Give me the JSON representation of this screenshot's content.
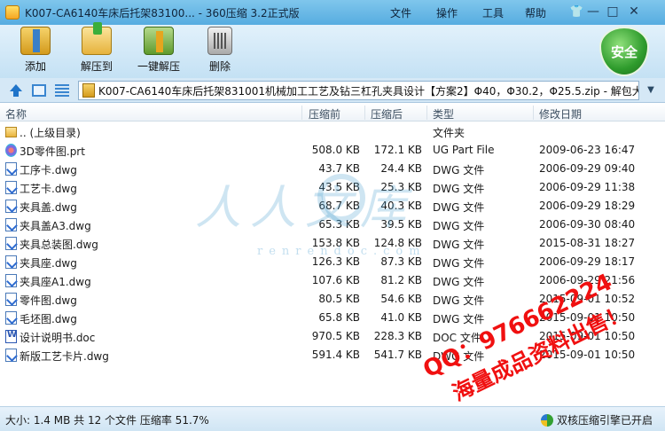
{
  "window": {
    "title": "K007-CA6140车床后托架83100... - 360压缩 3.2正式版",
    "menu": [
      "文件",
      "操作",
      "工具",
      "帮助"
    ],
    "controls": {
      "minimize": "—",
      "maximize": "□",
      "close": "✕"
    }
  },
  "toolbar": {
    "add": "添加",
    "extract": "解压到",
    "one_click": "一键解压",
    "delete": "删除",
    "security_badge": "安全"
  },
  "address": {
    "path": "K007-CA6140车床后托架831001机械加工工艺及钻三杠孔夹具设计【方案2】Φ40，Φ30.2，Φ25.5.zip - 解包大小",
    "dropdown_glyph": "▼"
  },
  "columns": {
    "name": "名称",
    "size": "压缩前",
    "compressed": "压缩后",
    "type": "类型",
    "modified": "修改日期"
  },
  "files": [
    {
      "icon": "folder-icon",
      "name": ".. (上级目录)",
      "size": "",
      "compressed": "",
      "type": "文件夹",
      "modified": ""
    },
    {
      "icon": "prt-file-icon",
      "name": "3D零件图.prt",
      "size": "508.0 KB",
      "compressed": "172.1 KB",
      "type": "UG Part File",
      "modified": "2009-06-23 16:47"
    },
    {
      "icon": "dwg-file-icon",
      "name": "工序卡.dwg",
      "size": "43.7 KB",
      "compressed": "24.4 KB",
      "type": "DWG 文件",
      "modified": "2006-09-29 09:40"
    },
    {
      "icon": "dwg-file-icon",
      "name": "工艺卡.dwg",
      "size": "43.5 KB",
      "compressed": "25.3 KB",
      "type": "DWG 文件",
      "modified": "2006-09-29 11:38"
    },
    {
      "icon": "dwg-file-icon",
      "name": "夹具盖.dwg",
      "size": "68.7 KB",
      "compressed": "40.3 KB",
      "type": "DWG 文件",
      "modified": "2006-09-29 18:29"
    },
    {
      "icon": "dwg-file-icon",
      "name": "夹具盖A3.dwg",
      "size": "65.3 KB",
      "compressed": "39.5 KB",
      "type": "DWG 文件",
      "modified": "2006-09-30 08:40"
    },
    {
      "icon": "dwg-file-icon",
      "name": "夹具总装图.dwg",
      "size": "153.8 KB",
      "compressed": "124.8 KB",
      "type": "DWG 文件",
      "modified": "2015-08-31 18:27"
    },
    {
      "icon": "dwg-file-icon",
      "name": "夹具座.dwg",
      "size": "126.3 KB",
      "compressed": "87.3 KB",
      "type": "DWG 文件",
      "modified": "2006-09-29 18:17"
    },
    {
      "icon": "dwg-file-icon",
      "name": "夹具座A1.dwg",
      "size": "107.6 KB",
      "compressed": "81.2 KB",
      "type": "DWG 文件",
      "modified": "2006-09-29 21:56"
    },
    {
      "icon": "dwg-file-icon",
      "name": "零件图.dwg",
      "size": "80.5 KB",
      "compressed": "54.6 KB",
      "type": "DWG 文件",
      "modified": "2015-09-01 10:52"
    },
    {
      "icon": "dwg-file-icon",
      "name": "毛坯图.dwg",
      "size": "65.8 KB",
      "compressed": "41.0 KB",
      "type": "DWG 文件",
      "modified": "2015-09-01 10:50"
    },
    {
      "icon": "doc-file-icon",
      "name": "设计说明书.doc",
      "size": "970.5 KB",
      "compressed": "228.3 KB",
      "type": "DOC 文件",
      "modified": "2015-09-01 10:50"
    },
    {
      "icon": "dwg-file-icon",
      "name": "新版工艺卡片.dwg",
      "size": "591.4 KB",
      "compressed": "541.7 KB",
      "type": "DWG 文件",
      "modified": "2015-09-01 10:50"
    }
  ],
  "watermark": {
    "logo": "人人文库",
    "site": "renrendoc.com",
    "promo_line1": "QQ：976662224",
    "promo_line2": "海量成品资料出售！"
  },
  "status": {
    "summary": "大小: 1.4 MB 共 12 个文件 压缩率 51.7%",
    "engine": "双核压缩引擎已开启"
  },
  "colors": {
    "titlebar": "#56ace0",
    "toolbar": "#c4e1f4",
    "shield": "#2e9b2c",
    "promo_red": "#f01010"
  }
}
